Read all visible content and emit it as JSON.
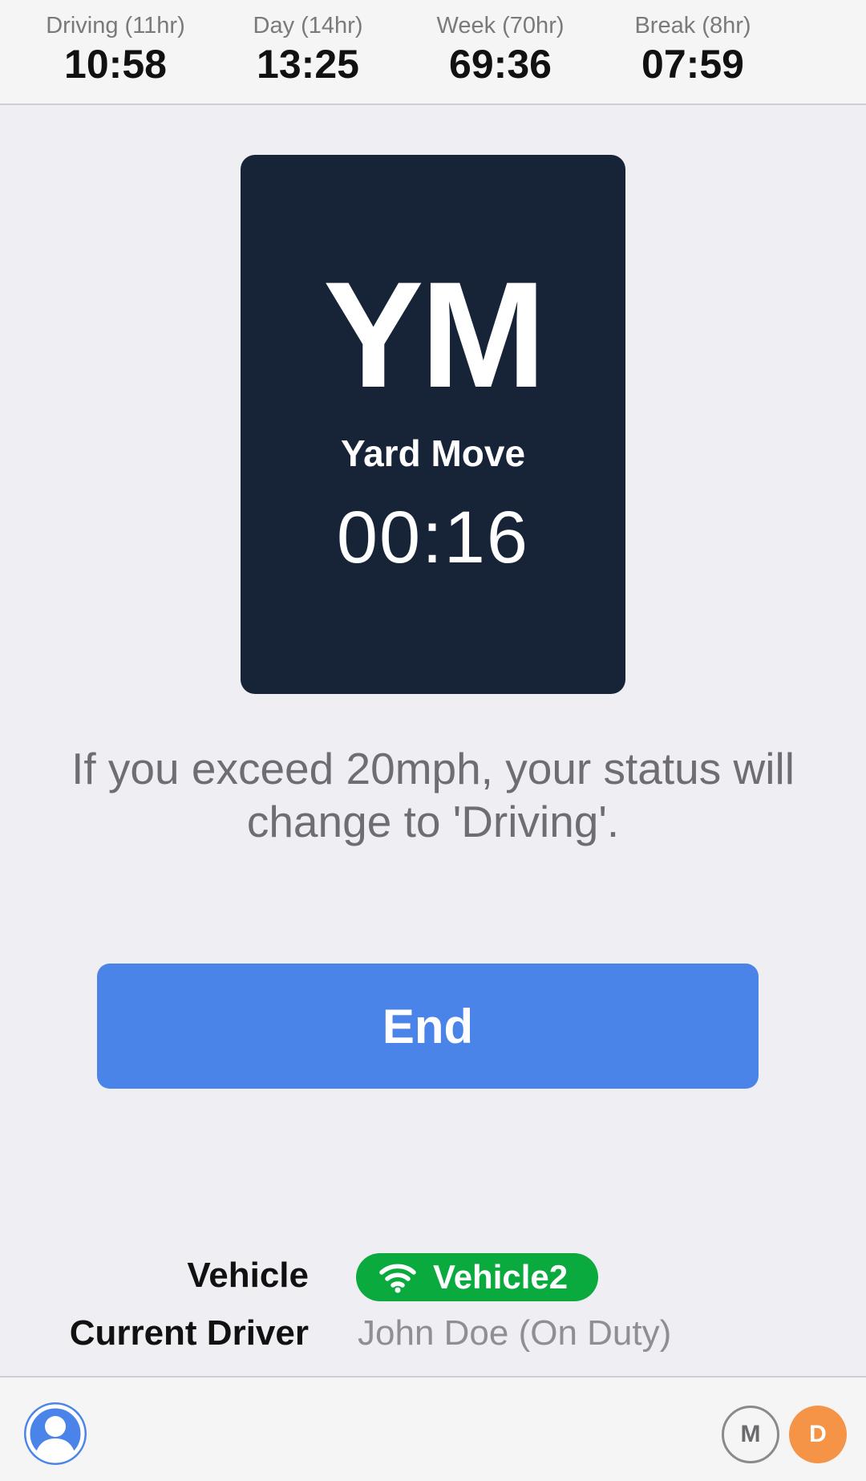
{
  "clocks": [
    {
      "label": "Driving (11hr)",
      "value": "10:58"
    },
    {
      "label": "Day (14hr)",
      "value": "13:25"
    },
    {
      "label": "Week (70hr)",
      "value": "69:36"
    },
    {
      "label": "Break (8hr)",
      "value": "07:59"
    }
  ],
  "status": {
    "code": "YM",
    "name": "Yard Move",
    "timer": "00:16"
  },
  "notice": "If you exceed 20mph, your status will change to 'Driving'.",
  "end_button": "End",
  "vehicle": {
    "label": "Vehicle",
    "name": "Vehicle2",
    "icon": "wifi-icon",
    "pill_color": "#0aaa3e"
  },
  "driver": {
    "label": "Current Driver",
    "value": "John Doe (On Duty)"
  },
  "bottom_bar": {
    "profile_icon": "user-icon",
    "m_label": "M",
    "d_label": "D"
  },
  "colors": {
    "accent": "#4a84e9",
    "card": "#172337",
    "d_badge": "#f59347"
  }
}
